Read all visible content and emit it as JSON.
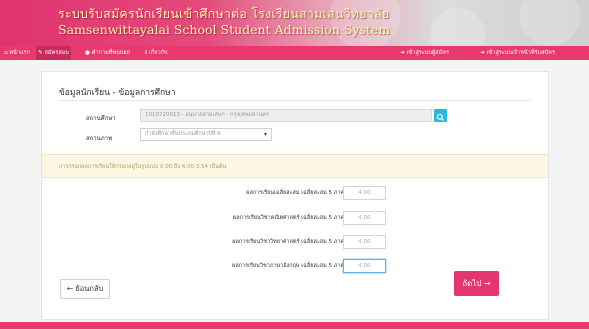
{
  "header": {
    "title_th": "ระบบรับสมัครนักเรียนเข้าศึกษาต่อ โรงเรียนสามเสนวิทยาลัย",
    "title_en": "Samsenwittayalai School Student Admission System"
  },
  "nav": {
    "left": [
      {
        "icon": "home-icon",
        "label": "หน้าแรก"
      },
      {
        "icon": "edit-icon",
        "label": "สมัครสอบ"
      },
      {
        "icon": "question-icon",
        "label": "คำถามที่พบบ่อย"
      },
      {
        "icon": "info-icon",
        "label": "เกี่ยวกับ"
      }
    ],
    "right": [
      {
        "icon": "login-icon",
        "label": "เข้าสู่ระบบผู้สมัคร"
      },
      {
        "icon": "login-icon",
        "label": "เข้าสู่ระบบเจ้าหน้าที่รับสมัคร"
      }
    ]
  },
  "panel": {
    "heading": "ข้อมูลนักเรียน - ข้อมูลการศึกษา",
    "school_label": "สถานศึกษา",
    "school_value": "1010720013 - อนุบาลสามเสนฯ - กรุงเทพมหานคร",
    "status_label": "สถานภาพ",
    "status_value": "กำลังศึกษาชั้นประถมศึกษาปีที่ 6",
    "notice": "การกรอกผลการเรียนให้กรอกอยู่ในรูปแบบ 0.00 ถึง 4.00 3.54 เป็นต้น",
    "grades": [
      {
        "label": "ผลการเรียนเฉลี่ยสะสม เฉลี่ยสะสม 5 ภาคเรียน",
        "value": "4.00"
      },
      {
        "label": "ผลการเรียนวิชาคณิตศาสตร์ เฉลี่ยสะสม 5 ภาคเรียน",
        "value": "4.00"
      },
      {
        "label": "ผลการเรียนวิชาวิทยาศาสตร์ เฉลี่ยสะสม 5 ภาคเรียน",
        "value": "4.00"
      },
      {
        "label": "ผลการเรียนวิชาภาษาอังกฤษ เฉลี่ยสะสม 5 ภาคเรียน",
        "value": "4.00"
      }
    ],
    "back_label": "← ย้อนกลับ",
    "next_label": "ถัดไป →"
  },
  "colors": {
    "brand": "#e8386e",
    "accent": "#2db7e0",
    "notice_bg": "#fcf7e3"
  }
}
